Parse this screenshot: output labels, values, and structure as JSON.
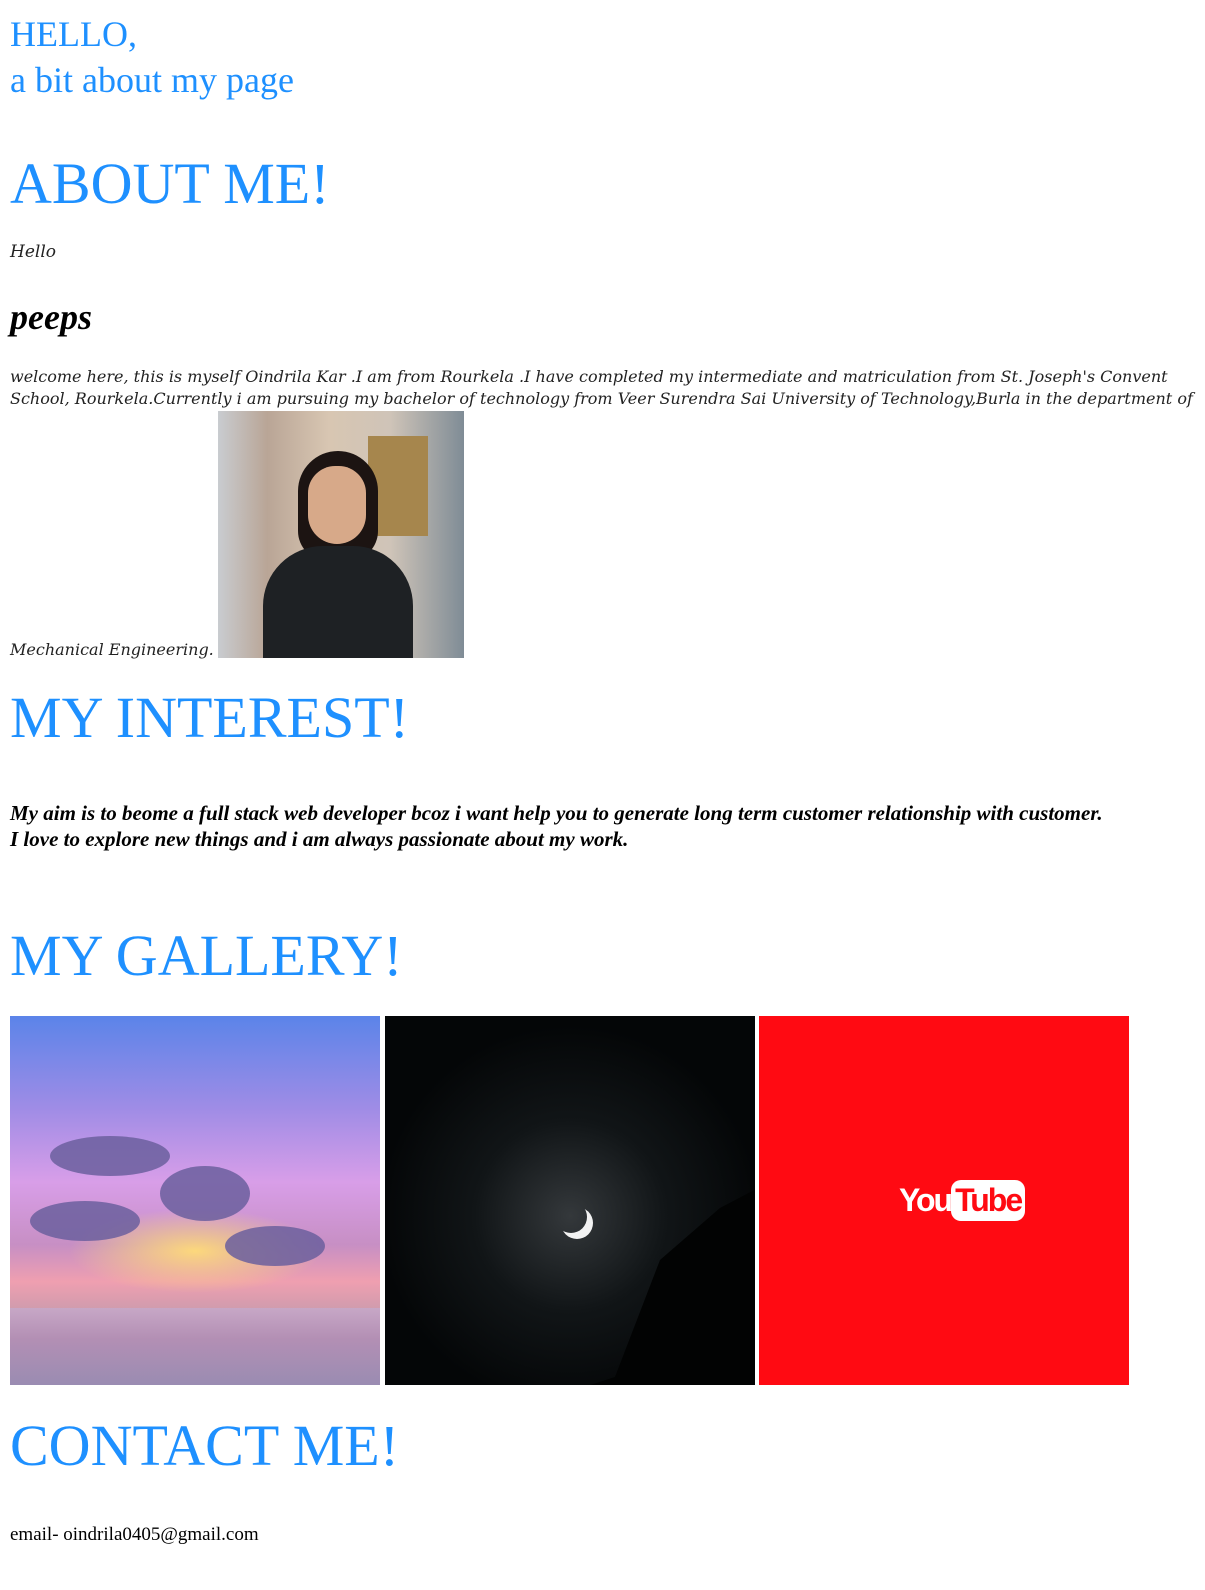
{
  "header": {
    "line1": "HELLO,",
    "line2": "a bit about my page"
  },
  "about": {
    "heading": "ABOUT ME!",
    "hello": "Hello",
    "peeps": "peeps",
    "bio": "welcome here, this is myself Oindrila Kar .I am from Rourkela .I have completed my intermediate and matriculation from St. Joseph's Convent School, Rourkela.Currently i am pursuing my bachelor of technology from Veer Surendra Sai University of Technology,Burla in the department of",
    "bio_end": "Mechanical Engineering."
  },
  "interest": {
    "heading": "MY INTEREST!",
    "text_line1": "My aim is to beome a full stack web developer bcoz i want help you to generate long term customer relationship with customer.",
    "text_line2": "I love to explore new things and i am always passionate about my work."
  },
  "gallery": {
    "heading": "MY GALLERY!",
    "logo_you": "You",
    "logo_tube": "Tube"
  },
  "contact": {
    "heading": "CONTACT ME!",
    "email": "email- oindrila0405@gmail.com"
  },
  "colors": {
    "heading_blue": "#1e90ff",
    "youtube_red": "#ff0a12"
  }
}
